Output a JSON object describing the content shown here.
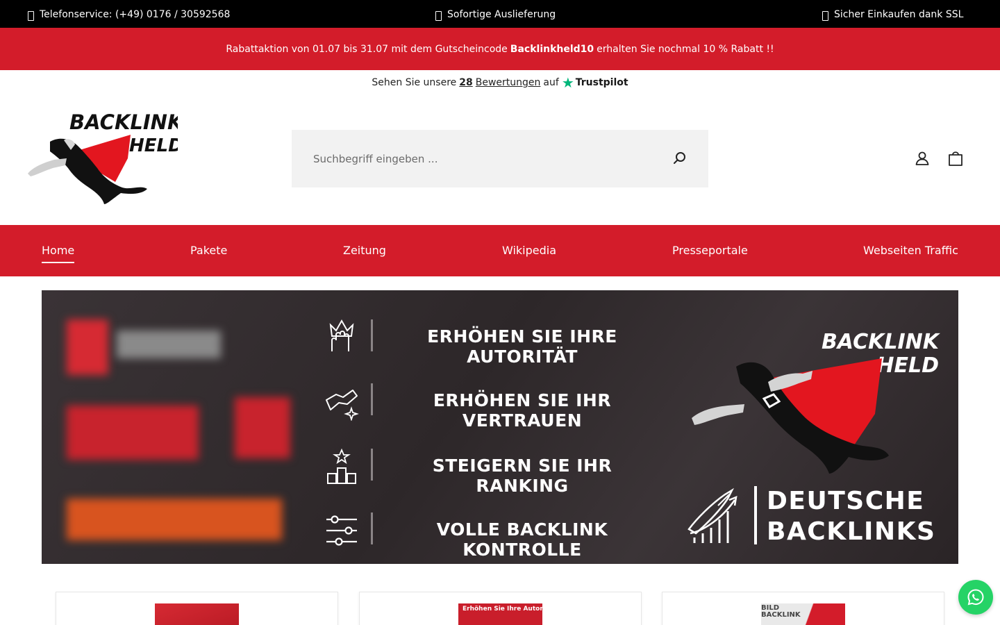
{
  "topbar": {
    "phone": "Telefonservice: (+49) 0176 / 30592568",
    "delivery": "Sofortige Auslieferung",
    "ssl": "Sicher Einkaufen dank SSL",
    "icon_color": "#ffffff"
  },
  "promo": {
    "before": "Rabattaktion von 01.07 bis 31.07 mit dem Gutscheincode",
    "code": "Backlinkheld10",
    "after": "erhalten Sie nochmal 10 % Rabatt !!",
    "background": "#d31c2a"
  },
  "trustpilot": {
    "lead": "Sehen Sie unsere",
    "count": "28",
    "reviews": "Bewertungen",
    "on": "auf",
    "brand": "Trustpilot",
    "star_color": "#00b67a"
  },
  "logo": {
    "line1": "BACKLINK",
    "line2": "HELD"
  },
  "search": {
    "placeholder": "Suchbegriff eingeben ...",
    "value": ""
  },
  "header_icons": [
    "user-icon",
    "shopping-bag-icon"
  ],
  "nav": {
    "items": [
      {
        "label": "Home",
        "active": true
      },
      {
        "label": "Pakete",
        "active": false
      },
      {
        "label": "Zeitung",
        "active": false
      },
      {
        "label": "Wikipedia",
        "active": false
      },
      {
        "label": "Presseportale",
        "active": false
      },
      {
        "label": "Webseiten Traffic",
        "active": false
      }
    ],
    "background": "#d31c2a"
  },
  "banner": {
    "features": [
      {
        "icon": "hand-crown-icon",
        "text": "ERHÖHEN SIE IHRE AUTORITÄT"
      },
      {
        "icon": "handshake-icon",
        "text": "ERHÖHEN SIE IHR VERTRAUEN"
      },
      {
        "icon": "ranking-podium-icon",
        "text": "STEIGERN SIE IHR RANKING"
      },
      {
        "icon": "sliders-icon",
        "text": "VOLLE BACKLINK KONTROLLE"
      }
    ],
    "brand_line1": "BACKLINK",
    "brand_line2": "HELD",
    "tagline_line1": "DEUTSCHE",
    "tagline_line2": "BACKLINKS"
  },
  "cards": [
    {
      "thumb_text": ""
    },
    {
      "thumb_text": "Erhöhen Sie Ihre Autorität!"
    },
    {
      "thumb_text": "BILD BACKLINK"
    }
  ],
  "whatsapp": {
    "icon": "whatsapp-icon",
    "color": "#25d366"
  }
}
